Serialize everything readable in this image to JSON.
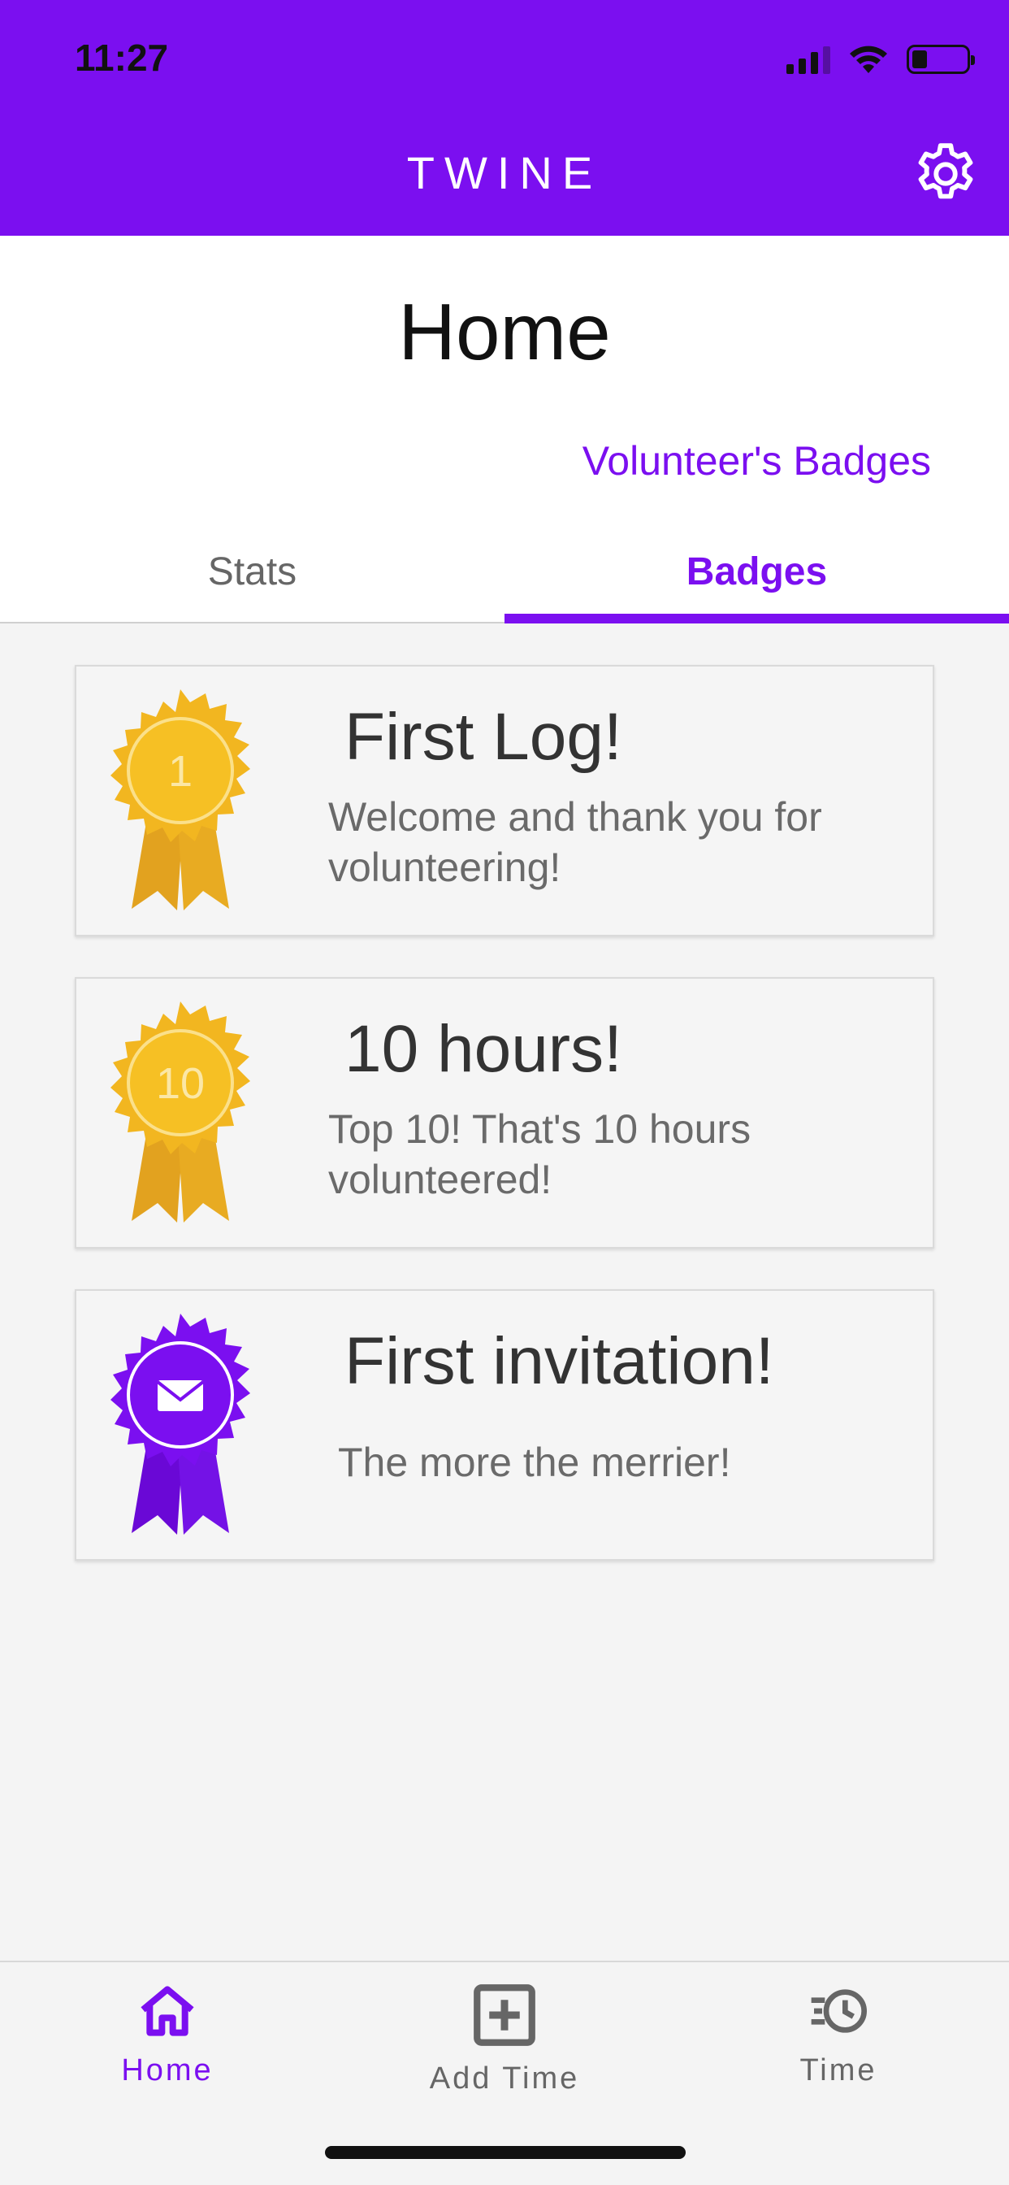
{
  "status_bar": {
    "time": "11:27"
  },
  "app": {
    "title": "TWINE"
  },
  "page": {
    "title": "Home",
    "section_label": "Volunteer's Badges"
  },
  "tabs": [
    {
      "label": "Stats",
      "active": false
    },
    {
      "label": "Badges",
      "active": true
    }
  ],
  "badges": [
    {
      "title": "First Log!",
      "description": "Welcome and thank you for volunteering!",
      "icon": "gold-ribbon-1-icon",
      "ribbon_text": "1",
      "color": "#f2b620"
    },
    {
      "title": "10 hours!",
      "description": "Top 10! That's 10 hours volunteered!",
      "icon": "gold-ribbon-10-icon",
      "ribbon_text": "10",
      "color": "#f2b620"
    },
    {
      "title": "First invitation!",
      "description": "The more the merrier!",
      "icon": "purple-ribbon-envelope-icon",
      "color": "#7b0ff0"
    }
  ],
  "bottom_nav": [
    {
      "label": "Home",
      "icon": "home-icon",
      "active": true
    },
    {
      "label": "Add Time",
      "icon": "add-box-icon",
      "active": false
    },
    {
      "label": "Time",
      "icon": "history-icon",
      "active": false
    }
  ],
  "colors": {
    "brand": "#7b0ff0",
    "gold": "#f2b620",
    "background": "#f4f4f4"
  }
}
